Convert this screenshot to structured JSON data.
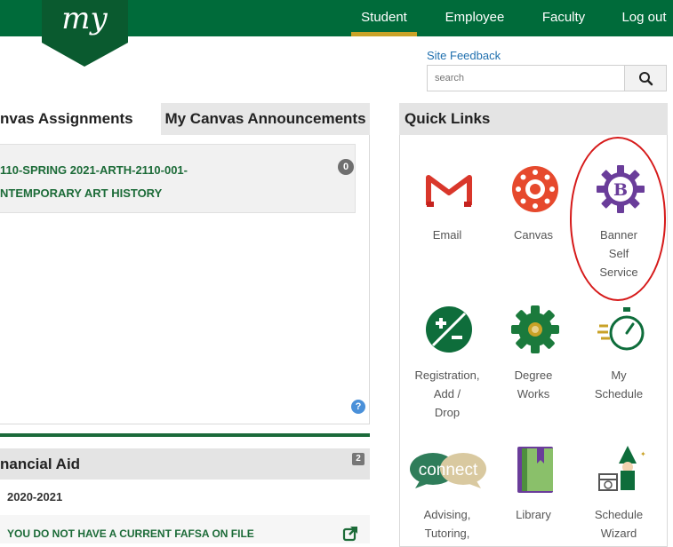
{
  "header": {
    "logo_text": "my",
    "nav": [
      {
        "label": "Student",
        "active": true
      },
      {
        "label": "Employee",
        "active": false
      },
      {
        "label": "Faculty",
        "active": false
      },
      {
        "label": "Log out",
        "active": false
      }
    ],
    "brand_color": "#006b3a",
    "active_color": "#c9a227"
  },
  "utility": {
    "feedback_link": "Site Feedback",
    "search_placeholder": "search"
  },
  "canvas_panel": {
    "tabs": [
      "nvas Assignments",
      "My Canvas Announcements"
    ],
    "course_line1": "110-SPRING 2021-ARTH-2110-001-",
    "course_line2": "NTEMPORARY ART HISTORY",
    "course_count": "0",
    "help_icon": "?"
  },
  "financial_aid": {
    "title": "nancial Aid",
    "badge": "2",
    "year": "2020-2021",
    "message": "YOU DO NOT HAVE A CURRENT FAFSA ON FILE"
  },
  "quick_links": {
    "title": "Quick Links",
    "items": [
      {
        "label": "Email",
        "icon": "gmail-icon"
      },
      {
        "label": "Canvas",
        "icon": "canvas-icon"
      },
      {
        "label": "Banner Self Service",
        "icon": "banner-gear-icon",
        "highlighted": true
      },
      {
        "label": "Registration, Add / Drop",
        "icon": "registration-icon"
      },
      {
        "label": "Degree Works",
        "icon": "degree-works-gear-icon"
      },
      {
        "label": "My Schedule",
        "icon": "stopwatch-icon"
      },
      {
        "label": "Advising, Tutoring,",
        "icon": "connect-icon"
      },
      {
        "label": "Library",
        "icon": "book-icon"
      },
      {
        "label": "Schedule Wizard",
        "icon": "wizard-icon"
      }
    ],
    "labels_lines": [
      [
        "Email"
      ],
      [
        "Canvas"
      ],
      [
        "Banner",
        "Self",
        "Service"
      ],
      [
        "Registration,",
        "Add /",
        "Drop"
      ],
      [
        "Degree",
        "Works"
      ],
      [
        "My",
        "Schedule"
      ],
      [
        "Advising,",
        "Tutoring,"
      ],
      [
        "Library"
      ],
      [
        "Schedule",
        "Wizard"
      ]
    ],
    "connect_text": "connect",
    "banner_letter": "B"
  }
}
